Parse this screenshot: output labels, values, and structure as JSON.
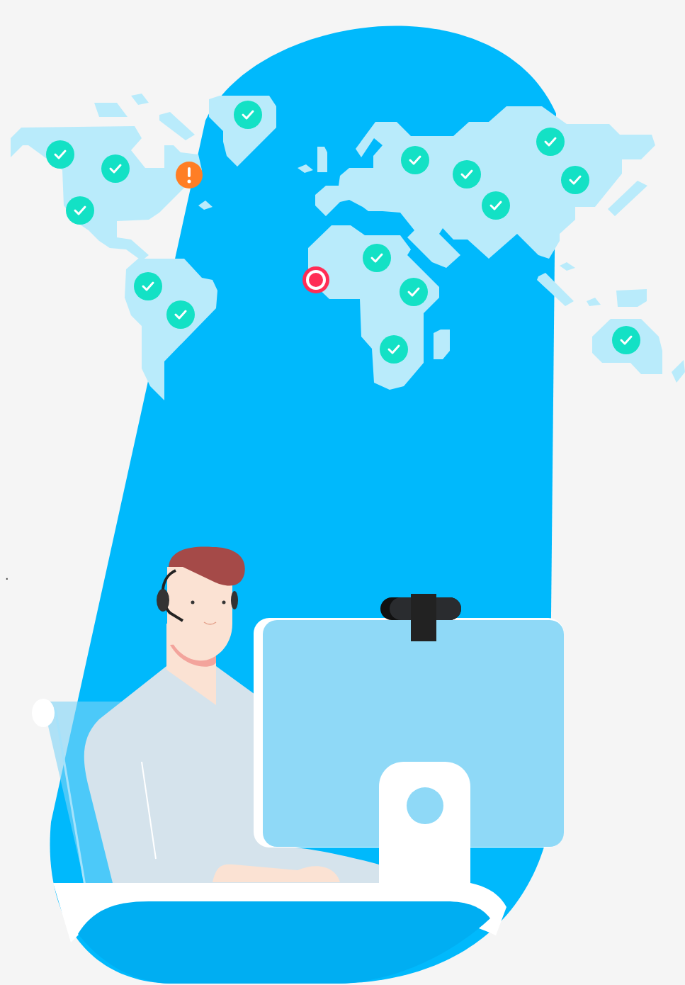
{
  "text_fragment": "."
}
